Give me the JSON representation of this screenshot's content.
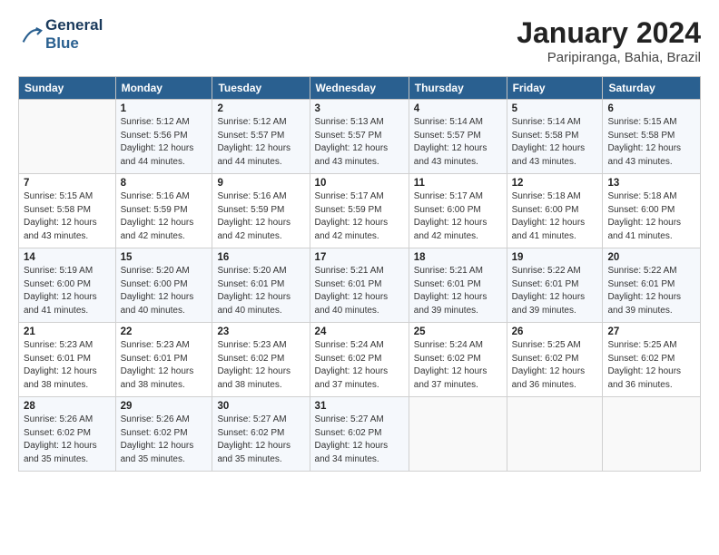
{
  "logo": {
    "line1": "General",
    "line2": "Blue"
  },
  "title": "January 2024",
  "location": "Paripiranga, Bahia, Brazil",
  "columns": [
    "Sunday",
    "Monday",
    "Tuesday",
    "Wednesday",
    "Thursday",
    "Friday",
    "Saturday"
  ],
  "weeks": [
    [
      {
        "day": "",
        "detail": ""
      },
      {
        "day": "1",
        "detail": "Sunrise: 5:12 AM\nSunset: 5:56 PM\nDaylight: 12 hours\nand 44 minutes."
      },
      {
        "day": "2",
        "detail": "Sunrise: 5:12 AM\nSunset: 5:57 PM\nDaylight: 12 hours\nand 44 minutes."
      },
      {
        "day": "3",
        "detail": "Sunrise: 5:13 AM\nSunset: 5:57 PM\nDaylight: 12 hours\nand 43 minutes."
      },
      {
        "day": "4",
        "detail": "Sunrise: 5:14 AM\nSunset: 5:57 PM\nDaylight: 12 hours\nand 43 minutes."
      },
      {
        "day": "5",
        "detail": "Sunrise: 5:14 AM\nSunset: 5:58 PM\nDaylight: 12 hours\nand 43 minutes."
      },
      {
        "day": "6",
        "detail": "Sunrise: 5:15 AM\nSunset: 5:58 PM\nDaylight: 12 hours\nand 43 minutes."
      }
    ],
    [
      {
        "day": "7",
        "detail": "Sunrise: 5:15 AM\nSunset: 5:58 PM\nDaylight: 12 hours\nand 43 minutes."
      },
      {
        "day": "8",
        "detail": "Sunrise: 5:16 AM\nSunset: 5:59 PM\nDaylight: 12 hours\nand 42 minutes."
      },
      {
        "day": "9",
        "detail": "Sunrise: 5:16 AM\nSunset: 5:59 PM\nDaylight: 12 hours\nand 42 minutes."
      },
      {
        "day": "10",
        "detail": "Sunrise: 5:17 AM\nSunset: 5:59 PM\nDaylight: 12 hours\nand 42 minutes."
      },
      {
        "day": "11",
        "detail": "Sunrise: 5:17 AM\nSunset: 6:00 PM\nDaylight: 12 hours\nand 42 minutes."
      },
      {
        "day": "12",
        "detail": "Sunrise: 5:18 AM\nSunset: 6:00 PM\nDaylight: 12 hours\nand 41 minutes."
      },
      {
        "day": "13",
        "detail": "Sunrise: 5:18 AM\nSunset: 6:00 PM\nDaylight: 12 hours\nand 41 minutes."
      }
    ],
    [
      {
        "day": "14",
        "detail": "Sunrise: 5:19 AM\nSunset: 6:00 PM\nDaylight: 12 hours\nand 41 minutes."
      },
      {
        "day": "15",
        "detail": "Sunrise: 5:20 AM\nSunset: 6:00 PM\nDaylight: 12 hours\nand 40 minutes."
      },
      {
        "day": "16",
        "detail": "Sunrise: 5:20 AM\nSunset: 6:01 PM\nDaylight: 12 hours\nand 40 minutes."
      },
      {
        "day": "17",
        "detail": "Sunrise: 5:21 AM\nSunset: 6:01 PM\nDaylight: 12 hours\nand 40 minutes."
      },
      {
        "day": "18",
        "detail": "Sunrise: 5:21 AM\nSunset: 6:01 PM\nDaylight: 12 hours\nand 39 minutes."
      },
      {
        "day": "19",
        "detail": "Sunrise: 5:22 AM\nSunset: 6:01 PM\nDaylight: 12 hours\nand 39 minutes."
      },
      {
        "day": "20",
        "detail": "Sunrise: 5:22 AM\nSunset: 6:01 PM\nDaylight: 12 hours\nand 39 minutes."
      }
    ],
    [
      {
        "day": "21",
        "detail": "Sunrise: 5:23 AM\nSunset: 6:01 PM\nDaylight: 12 hours\nand 38 minutes."
      },
      {
        "day": "22",
        "detail": "Sunrise: 5:23 AM\nSunset: 6:01 PM\nDaylight: 12 hours\nand 38 minutes."
      },
      {
        "day": "23",
        "detail": "Sunrise: 5:23 AM\nSunset: 6:02 PM\nDaylight: 12 hours\nand 38 minutes."
      },
      {
        "day": "24",
        "detail": "Sunrise: 5:24 AM\nSunset: 6:02 PM\nDaylight: 12 hours\nand 37 minutes."
      },
      {
        "day": "25",
        "detail": "Sunrise: 5:24 AM\nSunset: 6:02 PM\nDaylight: 12 hours\nand 37 minutes."
      },
      {
        "day": "26",
        "detail": "Sunrise: 5:25 AM\nSunset: 6:02 PM\nDaylight: 12 hours\nand 36 minutes."
      },
      {
        "day": "27",
        "detail": "Sunrise: 5:25 AM\nSunset: 6:02 PM\nDaylight: 12 hours\nand 36 minutes."
      }
    ],
    [
      {
        "day": "28",
        "detail": "Sunrise: 5:26 AM\nSunset: 6:02 PM\nDaylight: 12 hours\nand 35 minutes."
      },
      {
        "day": "29",
        "detail": "Sunrise: 5:26 AM\nSunset: 6:02 PM\nDaylight: 12 hours\nand 35 minutes."
      },
      {
        "day": "30",
        "detail": "Sunrise: 5:27 AM\nSunset: 6:02 PM\nDaylight: 12 hours\nand 35 minutes."
      },
      {
        "day": "31",
        "detail": "Sunrise: 5:27 AM\nSunset: 6:02 PM\nDaylight: 12 hours\nand 34 minutes."
      },
      {
        "day": "",
        "detail": ""
      },
      {
        "day": "",
        "detail": ""
      },
      {
        "day": "",
        "detail": ""
      }
    ]
  ]
}
